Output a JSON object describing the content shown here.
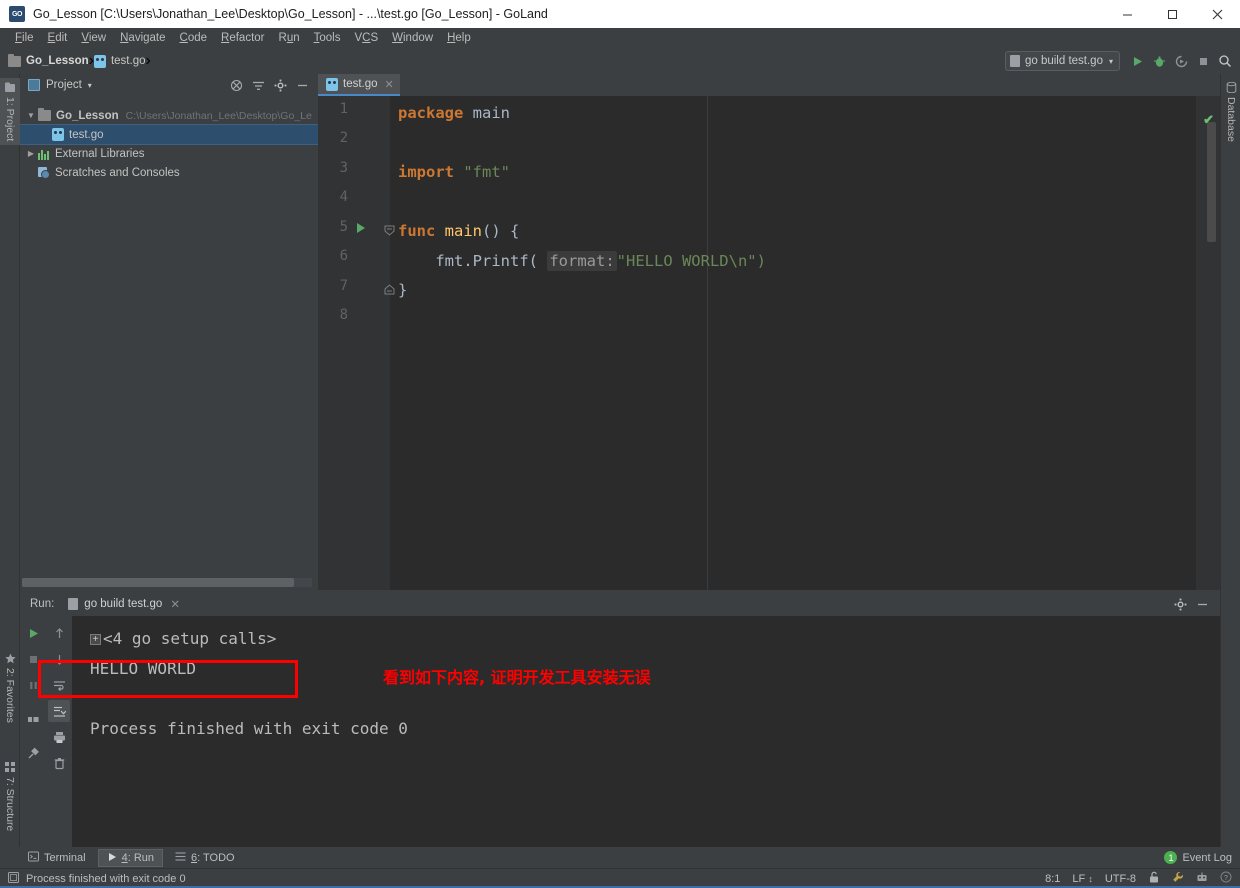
{
  "window": {
    "title": "Go_Lesson [C:\\Users\\Jonathan_Lee\\Desktop\\Go_Lesson] - ...\\test.go [Go_Lesson] - GoLand",
    "logo_text": "GO",
    "minimize_label": "—",
    "maximize_label": "☐",
    "close_label": "✕"
  },
  "menu": {
    "items": [
      {
        "label": "File",
        "mnemonic": "F"
      },
      {
        "label": "Edit",
        "mnemonic": "E"
      },
      {
        "label": "View",
        "mnemonic": "V"
      },
      {
        "label": "Navigate",
        "mnemonic": "N"
      },
      {
        "label": "Code",
        "mnemonic": "C"
      },
      {
        "label": "Refactor",
        "mnemonic": "R"
      },
      {
        "label": "Run",
        "mnemonic": "u"
      },
      {
        "label": "Tools",
        "mnemonic": "T"
      },
      {
        "label": "VCS",
        "mnemonic": "S"
      },
      {
        "label": "Window",
        "mnemonic": "W"
      },
      {
        "label": "Help",
        "mnemonic": "H"
      }
    ]
  },
  "breadcrumb": {
    "project": "Go_Lesson",
    "separator": "›",
    "file": "test.go"
  },
  "toolbar": {
    "run_config": "go build test.go",
    "run_config_caret": "▾",
    "run_icon": "run-icon",
    "debug_icon": "debug-icon",
    "coverage_icon": "run-with-coverage-icon",
    "stop_icon": "stop-icon",
    "search_icon": "search-icon"
  },
  "left_tabs": [
    {
      "label": "1: Project",
      "active": true
    },
    {
      "label": "2: Favorites",
      "active": false
    },
    {
      "label": "7: Structure",
      "active": false
    }
  ],
  "right_tabs": [
    {
      "label": "Database",
      "active": false
    }
  ],
  "project_panel": {
    "title": "Project",
    "caret": "▾",
    "tools": [
      "collapse-all-icon",
      "select-opened-file-icon",
      "settings-icon",
      "hide-icon"
    ],
    "tree": [
      {
        "label": "Go_Lesson",
        "path": "C:\\Users\\Jonathan_Lee\\Desktop\\Go_Le",
        "arrow": "▼",
        "indent": 0,
        "selected": false,
        "icon": "folder-icon"
      },
      {
        "label": "test.go",
        "path": "",
        "arrow": "",
        "indent": 1,
        "selected": true,
        "icon": "go-file-icon"
      },
      {
        "label": "External Libraries",
        "path": "",
        "arrow": "▶",
        "indent": 0,
        "selected": false,
        "icon": "library-icon"
      },
      {
        "label": "Scratches and Consoles",
        "path": "",
        "arrow": "",
        "indent": 0,
        "selected": false,
        "icon": "scratches-icon"
      }
    ]
  },
  "editor": {
    "tab_label": "test.go",
    "tab_close": "✕",
    "line_numbers": [
      "1",
      "2",
      "3",
      "4",
      "5",
      "6",
      "7",
      "8"
    ],
    "inspection_status": "✔",
    "lines": [
      {
        "num": "1",
        "text": "package main"
      },
      {
        "num": "2",
        "text": ""
      },
      {
        "num": "3",
        "text": "import \"fmt\""
      },
      {
        "num": "4",
        "text": ""
      },
      {
        "num": "5",
        "text": "func main() {"
      },
      {
        "num": "6",
        "text": "    fmt.Printf( format: \"HELLO WORLD\\n\")"
      },
      {
        "num": "7",
        "text": "}"
      },
      {
        "num": "8",
        "text": ""
      }
    ],
    "tokens": {
      "kw_package": "package",
      "id_main": "main",
      "kw_import": "import",
      "str_fmt": "\"fmt\"",
      "kw_func": "func",
      "fn_main": "main",
      "paren_main": "() {",
      "call_fmt": "fmt.Printf(",
      "param_hint": "format:",
      "str_hello": "\"HELLO WORLD\\n\")",
      "brace_close": "}"
    }
  },
  "run_panel": {
    "label": "Run:",
    "tab_label": "go build test.go",
    "tab_close": "✕",
    "tools": [
      "settings-icon",
      "hide-icon"
    ],
    "toolbar_left": [
      "rerun-icon",
      "stop-icon",
      "pause-icon",
      "dump-threads-icon",
      "pin-tab-icon"
    ],
    "toolbar_right": [
      "up-icon",
      "down-icon",
      "soft-wrap-icon",
      "scroll-to-end-icon",
      "print-icon",
      "clear-all-icon"
    ],
    "console": {
      "fold_expander": "+",
      "fold_label": "<4 go setup calls>",
      "output_line": "HELLO WORLD",
      "exit_line": "Process finished with exit code 0"
    },
    "annotation": {
      "text": "看到如下内容, 证明开发工具安装无误",
      "color": "#ff0000",
      "highlight_box_color": "#ff0000"
    }
  },
  "bottom_tabs": [
    {
      "label": "Terminal",
      "mnemonic": "",
      "icon": "terminal-icon",
      "active": false
    },
    {
      "label": "4: Run",
      "mnemonic": "4",
      "icon": "run-icon",
      "active": true
    },
    {
      "label": "6: TODO",
      "mnemonic": "6",
      "icon": "todo-icon",
      "active": false
    }
  ],
  "status_bar": {
    "message": "Process finished with exit code 0",
    "message_icon": "console-icon",
    "caret_position": "8:1",
    "line_separator": "LF",
    "line_separator_caret": "↕",
    "encoding": "UTF-8",
    "icons": [
      "lock-icon",
      "wrench-icon",
      "inspection-icon",
      "help-icon"
    ],
    "event_log": {
      "label": "Event Log",
      "count": "1",
      "color": "#4caf50"
    }
  }
}
